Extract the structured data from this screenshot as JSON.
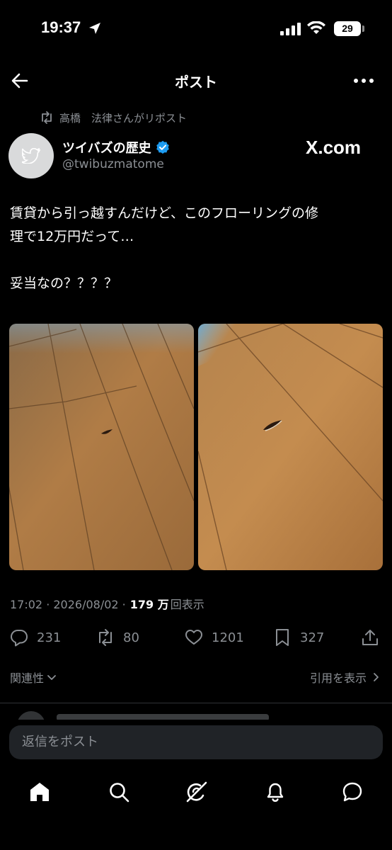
{
  "status_bar": {
    "time": "19:37",
    "battery": "29"
  },
  "nav": {
    "title": "ポスト"
  },
  "repost": {
    "text": "高橋　法律さんがリポスト"
  },
  "author": {
    "name": "ツイバズの歴史",
    "handle": "@twibuzmatome",
    "badge": "X.com"
  },
  "post": {
    "line1": "賃貸から引っ越すんだけど、このフローリングの修",
    "line2": "理で12万円だって…",
    "line3": "妥当なの？？？？"
  },
  "meta": {
    "time_date": "17:02 · 2026/08/02 ·",
    "views_num": "179 万",
    "views_label": "回表示"
  },
  "actions": {
    "replies": "231",
    "reposts": "80",
    "likes": "1201",
    "bookmarks": "327"
  },
  "sort": {
    "relevance": "関連性",
    "quotes": "引用を表示"
  },
  "reply": {
    "placeholder": "返信をポスト"
  },
  "colors": {
    "background": "#000000",
    "secondary_text": "#8b8f94",
    "verified": "#1d9bf0",
    "input_bg": "#202327"
  },
  "icons": {
    "back": "arrow-left-icon",
    "more": "more-horizontal-icon",
    "repost": "repost-icon",
    "verified": "verified-badge-icon",
    "reply": "comment-icon",
    "like": "heart-icon",
    "bookmark": "bookmark-icon",
    "share": "share-icon",
    "home": "home-icon",
    "search": "search-icon",
    "grok": "grok-icon",
    "notifications": "bell-icon",
    "messages": "message-icon"
  }
}
